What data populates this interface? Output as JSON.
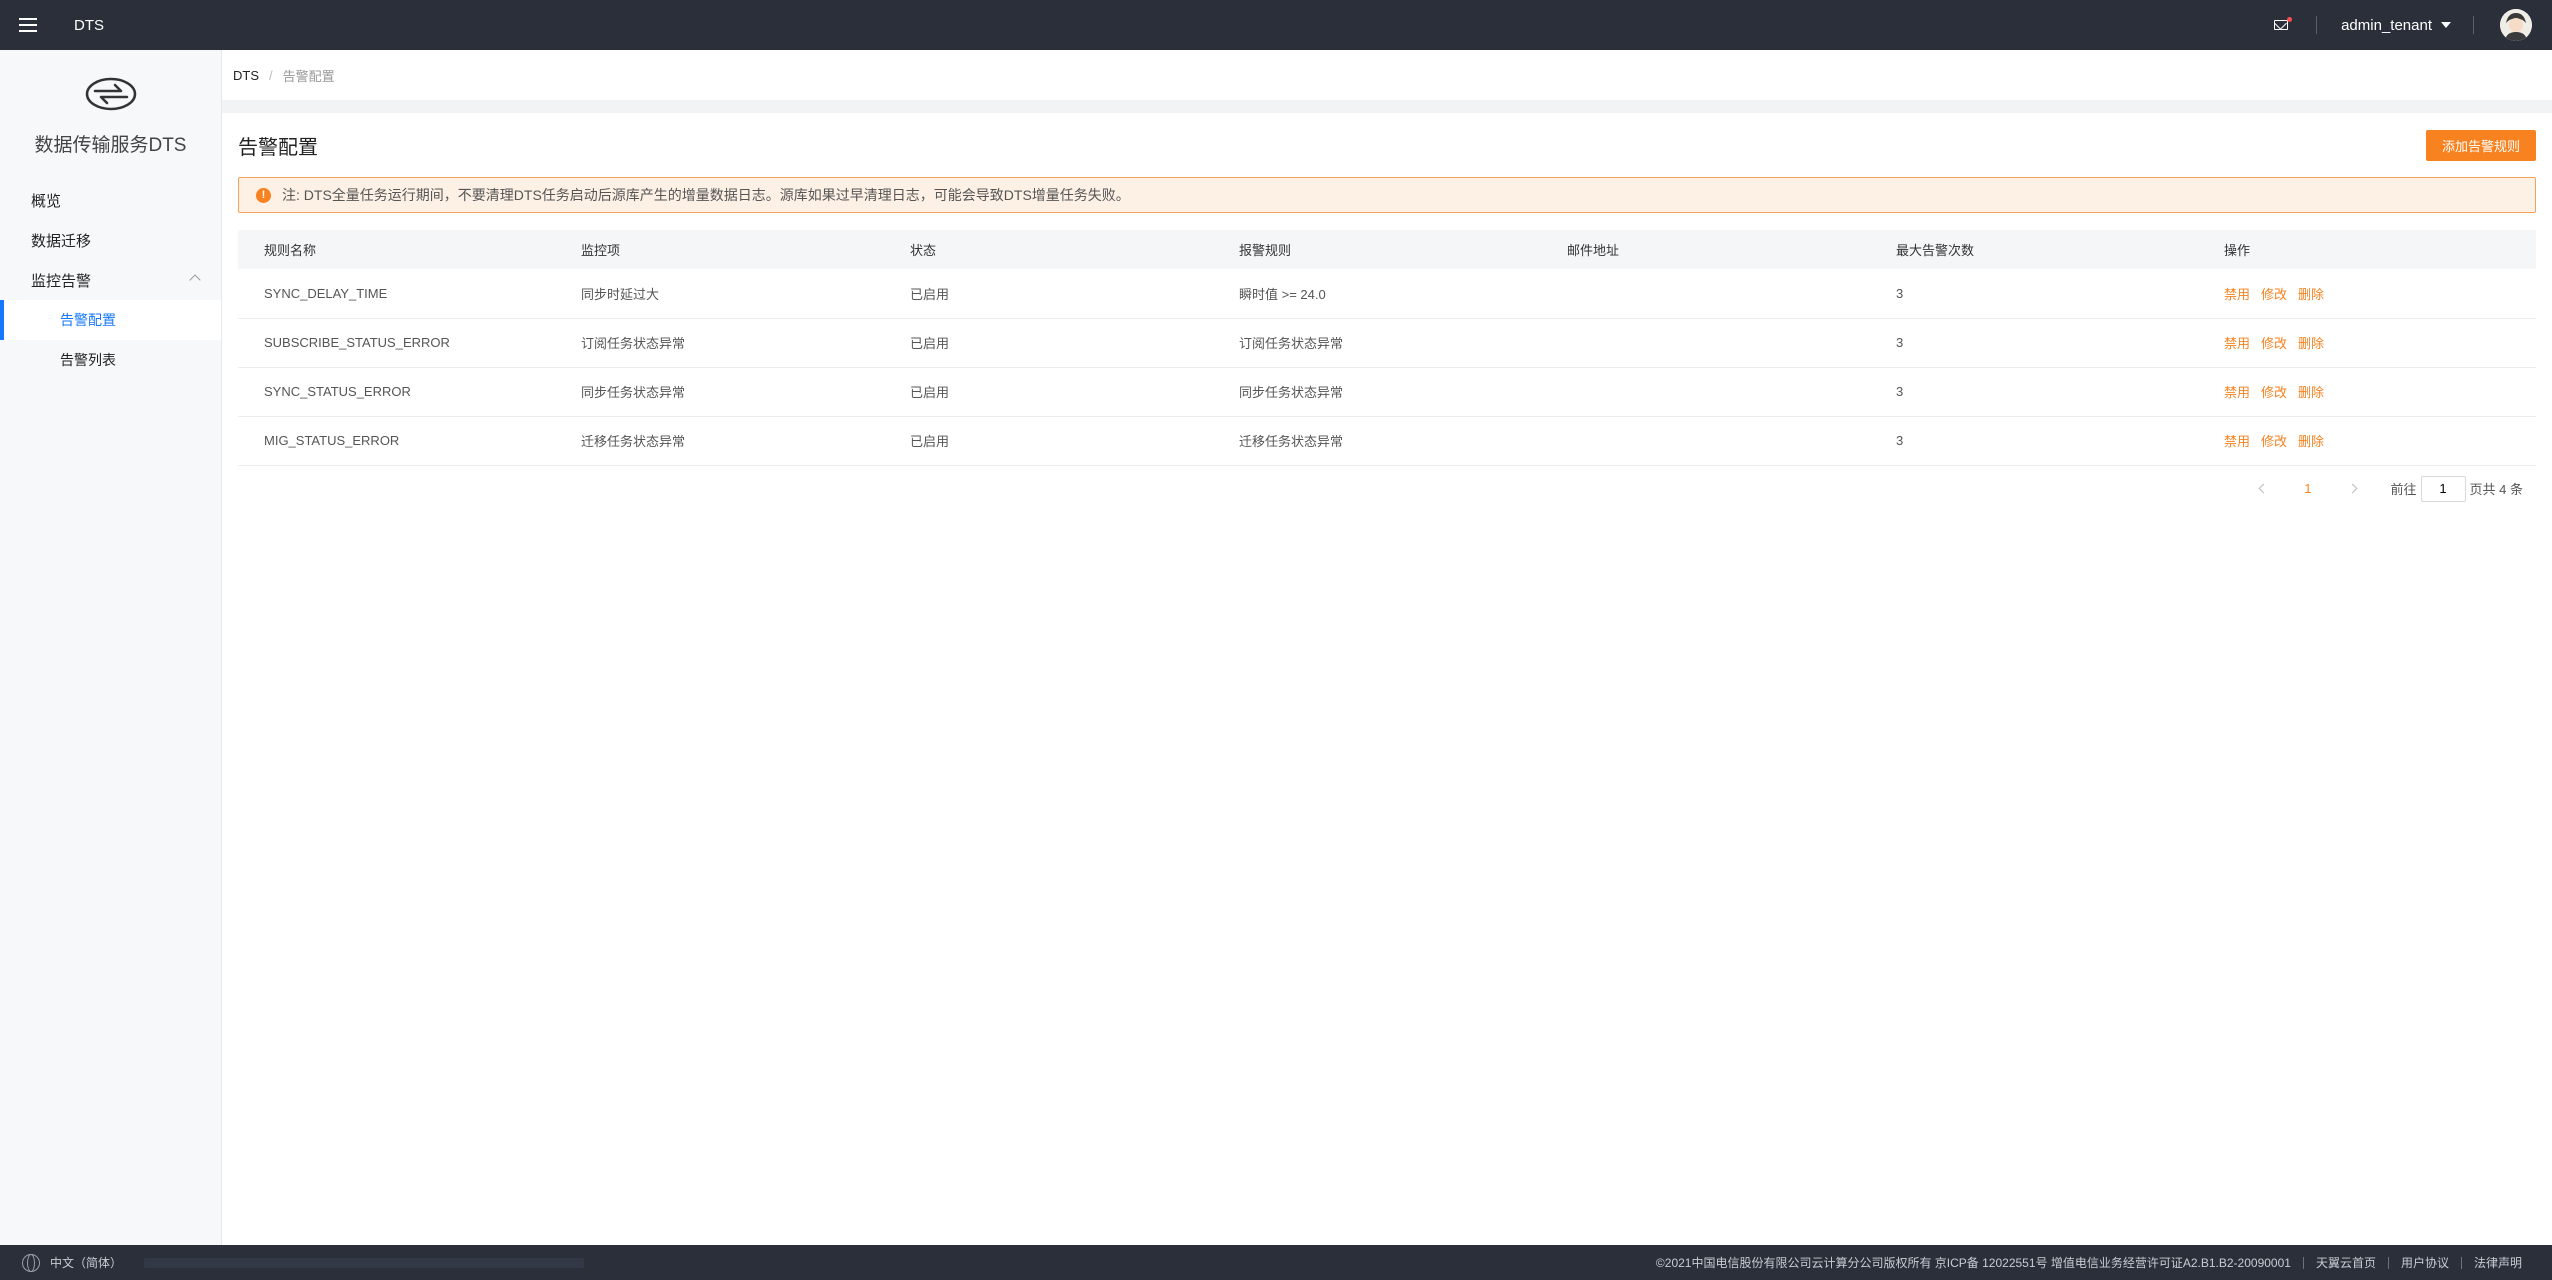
{
  "header": {
    "title": "DTS",
    "user": "admin_tenant"
  },
  "sidebar": {
    "brand": "数据传输服务DTS",
    "items": [
      {
        "label": "概览"
      },
      {
        "label": "数据迁移"
      },
      {
        "label": "监控告警"
      },
      {
        "label": "告警配置"
      },
      {
        "label": "告警列表"
      }
    ]
  },
  "breadcrumb": {
    "root": "DTS",
    "separator": "/",
    "current": "告警配置"
  },
  "page": {
    "title": "告警配置",
    "add_button": "添加告警规则",
    "notice": "注: DTS全量任务运行期间，不要清理DTS任务启动后源库产生的增量数据日志。源库如果过早清理日志，可能会导致DTS增量任务失败。"
  },
  "table": {
    "headers": [
      "规则名称",
      "监控项",
      "状态",
      "报警规则",
      "邮件地址",
      "最大告警次数",
      "操作"
    ],
    "rows": [
      {
        "name": "SYNC_DELAY_TIME",
        "item": "同步时延过大",
        "status": "已启用",
        "rule": "瞬时值 >= 24.0",
        "email": "",
        "max": "3"
      },
      {
        "name": "SUBSCRIBE_STATUS_ERROR",
        "item": "订阅任务状态异常",
        "status": "已启用",
        "rule": "订阅任务状态异常",
        "email": "",
        "max": "3"
      },
      {
        "name": "SYNC_STATUS_ERROR",
        "item": "同步任务状态异常",
        "status": "已启用",
        "rule": "同步任务状态异常",
        "email": "",
        "max": "3"
      },
      {
        "name": "MIG_STATUS_ERROR",
        "item": "迁移任务状态异常",
        "status": "已启用",
        "rule": "迁移任务状态异常",
        "email": "",
        "max": "3"
      }
    ],
    "actions": {
      "disable": "禁用",
      "edit": "修改",
      "delete": "删除"
    }
  },
  "pagination": {
    "current_page": "1",
    "goto_label": "前往",
    "goto_value": "1",
    "total_text": "页共 4 条"
  },
  "footer": {
    "language": "中文（简体）",
    "copyright": "©2021中国电信股份有限公司云计算分公司版权所有 京ICP备 12022551号 增值电信业务经营许可证A2.B1.B2-20090001",
    "links": [
      "天翼云首页",
      "用户协议",
      "法律声明"
    ]
  },
  "colors": {
    "accent": "#f7821f",
    "nav_active": "#1677ff",
    "topbar": "#2a2f3a"
  }
}
